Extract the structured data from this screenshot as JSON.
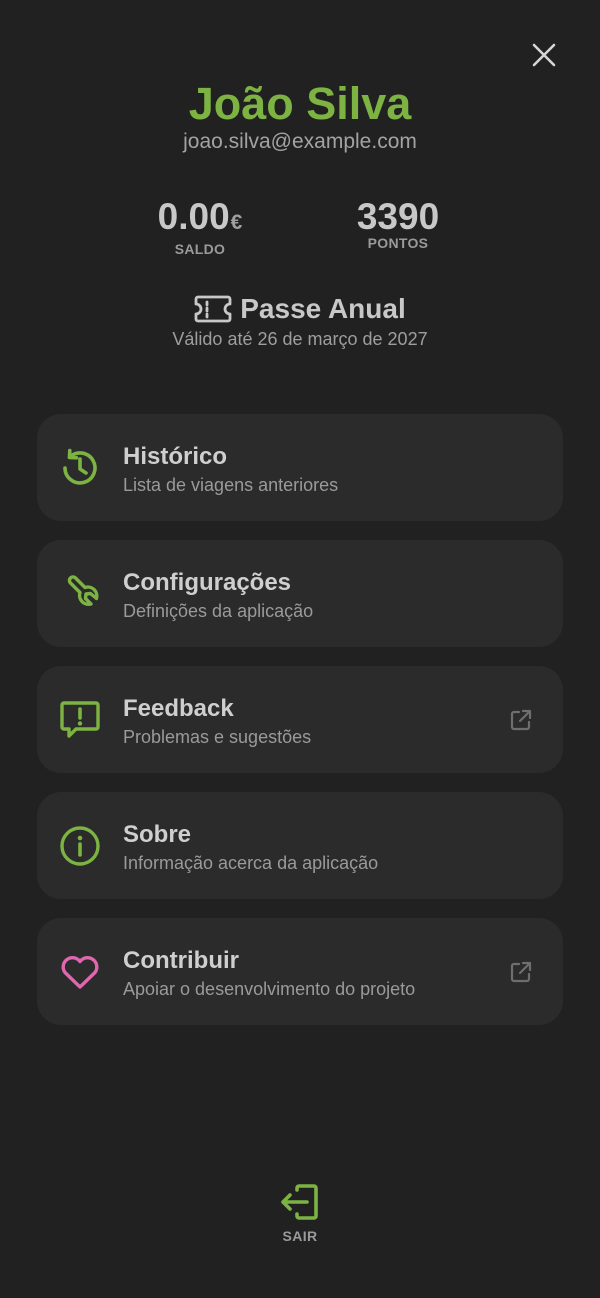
{
  "header": {
    "close_icon": "close-icon"
  },
  "profile": {
    "name": "João Silva",
    "email": "joao.silva@example.com"
  },
  "stats": {
    "saldo": {
      "value": "0.00",
      "unit": "€",
      "label": "SALDO"
    },
    "pontos": {
      "value": "3390",
      "label": "PONTOS"
    }
  },
  "pass": {
    "icon": "ticket-icon",
    "title": "Passe Anual",
    "validity": "Válido até 26 de março de 2027"
  },
  "menu": {
    "items": [
      {
        "title": "Histórico",
        "subtitle": "Lista de viagens anteriores",
        "icon": "history-icon",
        "external": false
      },
      {
        "title": "Configurações",
        "subtitle": "Definições da aplicação",
        "icon": "wrench-icon",
        "external": false
      },
      {
        "title": "Feedback",
        "subtitle": "Problemas e sugestões",
        "icon": "message-alert-icon",
        "external": true
      },
      {
        "title": "Sobre",
        "subtitle": "Informação acerca da aplicação",
        "icon": "info-icon",
        "external": false
      },
      {
        "title": "Contribuir",
        "subtitle": "Apoiar o desenvolvimento do projeto",
        "icon": "heart-icon",
        "external": true
      }
    ]
  },
  "logout": {
    "label": "SAIR",
    "icon": "logout-icon"
  },
  "colors": {
    "background": "#212121",
    "card": "#2b2b2b",
    "accent": "#7cb342",
    "heart": "#e066b0",
    "text_primary": "#cfcfcf",
    "text_secondary": "#9a9a9a"
  }
}
